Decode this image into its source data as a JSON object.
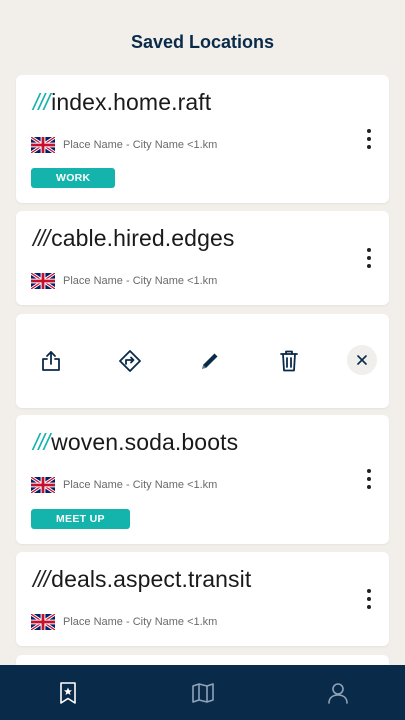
{
  "header": {
    "title": "Saved Locations"
  },
  "locations": [
    {
      "slashes": "///",
      "address": "index.home.raft",
      "place": "Place Name - City Name <1.km",
      "tag": "WORK",
      "slash_color": "#14b3ac"
    },
    {
      "slashes": "///",
      "address": "cable.hired.edges",
      "place": "Place Name - City Name <1.km",
      "slash_color": "#222222"
    },
    {
      "slashes": "///",
      "address": "woven.soda.boots",
      "place": "Place Name - City Name <1.km",
      "tag": "MEET UP",
      "slash_color": "#14b3ac"
    },
    {
      "slashes": "///",
      "address": "deals.aspect.transit",
      "place": "Place Name - City Name <1.km",
      "slash_color": "#222222"
    }
  ],
  "action_bar": {
    "icons": [
      "share-icon",
      "directions-icon",
      "edit-pencil-icon",
      "trash-icon",
      "close-icon"
    ]
  },
  "navbar": {
    "icons": [
      "saved-bookmark-icon",
      "map-icon",
      "profile-icon"
    ],
    "background": "#0a2a4a"
  },
  "colors": {
    "accent": "#14b3ac",
    "title": "#0a2a4a",
    "background": "#f2efea"
  }
}
